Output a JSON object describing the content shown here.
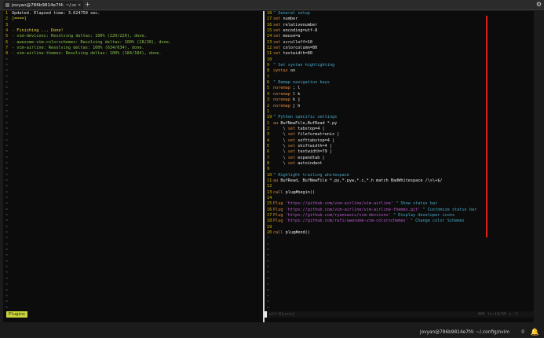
{
  "window": {
    "tab_title": "jovyan@786b9814e7f4: ~/.co",
    "tab_close": "×",
    "new_tab": "+",
    "settings_icon": "⚙"
  },
  "left_pane": {
    "lines": [
      {
        "num": "1",
        "text": "Updated. Elapsed time: 3.624750 sec."
      },
      {
        "num": "2",
        "text": "[====]"
      },
      {
        "num": "3",
        "text": ""
      },
      {
        "num": "4",
        "text": "- Finishing ... Done!"
      },
      {
        "num": "5",
        "text": "- vim-devicons: Resolving deltas: 100% (220/220), done."
      },
      {
        "num": "6",
        "text": "- awesome-vim-colorschemes: Resolving deltas: 100% (28/28), done."
      },
      {
        "num": "7",
        "text": "- vim-airline: Resolving deltas: 100% (634/634), done."
      },
      {
        "num": "8",
        "text": "- vim-airline-themes: Resolving deltas: 100% (184/184), done."
      }
    ],
    "tilde": "~"
  },
  "right_pane": {
    "lines": [
      {
        "num": "18",
        "text": "\" General setup"
      },
      {
        "num": "17",
        "text": "set number"
      },
      {
        "num": "16",
        "text": "set relativenumber"
      },
      {
        "num": "15",
        "text": "set encoding=utf-8"
      },
      {
        "num": "14",
        "text": "set mouse=a"
      },
      {
        "num": "13",
        "text": "set scrolloff=10"
      },
      {
        "num": "12",
        "text": "set colorcolumn=80"
      },
      {
        "num": "11",
        "text": "set textwidth=80"
      },
      {
        "num": "10",
        "text": ""
      },
      {
        "num": "9",
        "text": "\" Set syntax highlighting"
      },
      {
        "num": "8",
        "text": "syntax on"
      },
      {
        "num": "7",
        "text": ""
      },
      {
        "num": "6",
        "text": "\" Remap navigation keys"
      },
      {
        "num": "5",
        "text": "noremap ; l"
      },
      {
        "num": "4",
        "text": "noremap l k"
      },
      {
        "num": "3",
        "text": "noremap k j"
      },
      {
        "num": "2",
        "text": "noremap j h"
      },
      {
        "num": "1",
        "text": ""
      },
      {
        "num": "19",
        "text": "\" Python specific settings"
      },
      {
        "num": "1",
        "text": "au BufNewFile,BufRead *.py"
      },
      {
        "num": "2",
        "text": "    \\ set tabstop=4 |"
      },
      {
        "num": "3",
        "text": "    \\ set fileformat=unix |"
      },
      {
        "num": "4",
        "text": "    \\ set softtabstop=4 |"
      },
      {
        "num": "5",
        "text": "    \\ set shiftwidth=4 |"
      },
      {
        "num": "6",
        "text": "    \\ set textwidth=79 |"
      },
      {
        "num": "7",
        "text": "    \\ set expandtab |"
      },
      {
        "num": "8",
        "text": "    \\ set autoindent"
      },
      {
        "num": "9",
        "text": ""
      },
      {
        "num": "10",
        "text": "\" Highlight trailing whitespace"
      },
      {
        "num": "11",
        "text": "au BufRead, BufNewFile *.py,*.pyw,*.c,*.h match BadWhitespace /\\s\\+$/"
      },
      {
        "num": "12",
        "text": ""
      },
      {
        "num": "13",
        "text": "call plug#begin()"
      },
      {
        "num": "14",
        "text": ""
      },
      {
        "num": "15",
        "text": "Plug 'https://github.com/vim-airline/vim-airline' \" Show status bar"
      },
      {
        "num": "16",
        "text": "Plug 'https://github.com/vim-airline/vim-airline-themes.git' \" Customize status bar"
      },
      {
        "num": "17",
        "text": "Plug 'https://github.com/ryanoasis/vim-devicons' \" Display developer icons"
      },
      {
        "num": "18",
        "text": "Plug 'https://github.com/rafi/awesome-vim-colorschemes' \" Change color Schemes"
      },
      {
        "num": "19",
        "text": ""
      },
      {
        "num": "20",
        "text": "call plug#end()"
      }
    ],
    "tilde": "~"
  },
  "statusbar": {
    "left_label": "Plugins",
    "right_mode": "utf-8[unix]",
    "right_pos": "40% ln:19/39 ≡ :1"
  },
  "taskbar": {
    "prompt": "jovyan@786b9814e7f4: ~/.config/nvim",
    "count": "0",
    "bell_icon": "🔔"
  },
  "colors": {
    "line_number": "#d3b300",
    "comment": "#49a7c6",
    "keyword": "#d8873a",
    "string": "#b85ccc",
    "colorcolumn": "#e0201b",
    "status_plugins_bg": "#c9d53a"
  }
}
